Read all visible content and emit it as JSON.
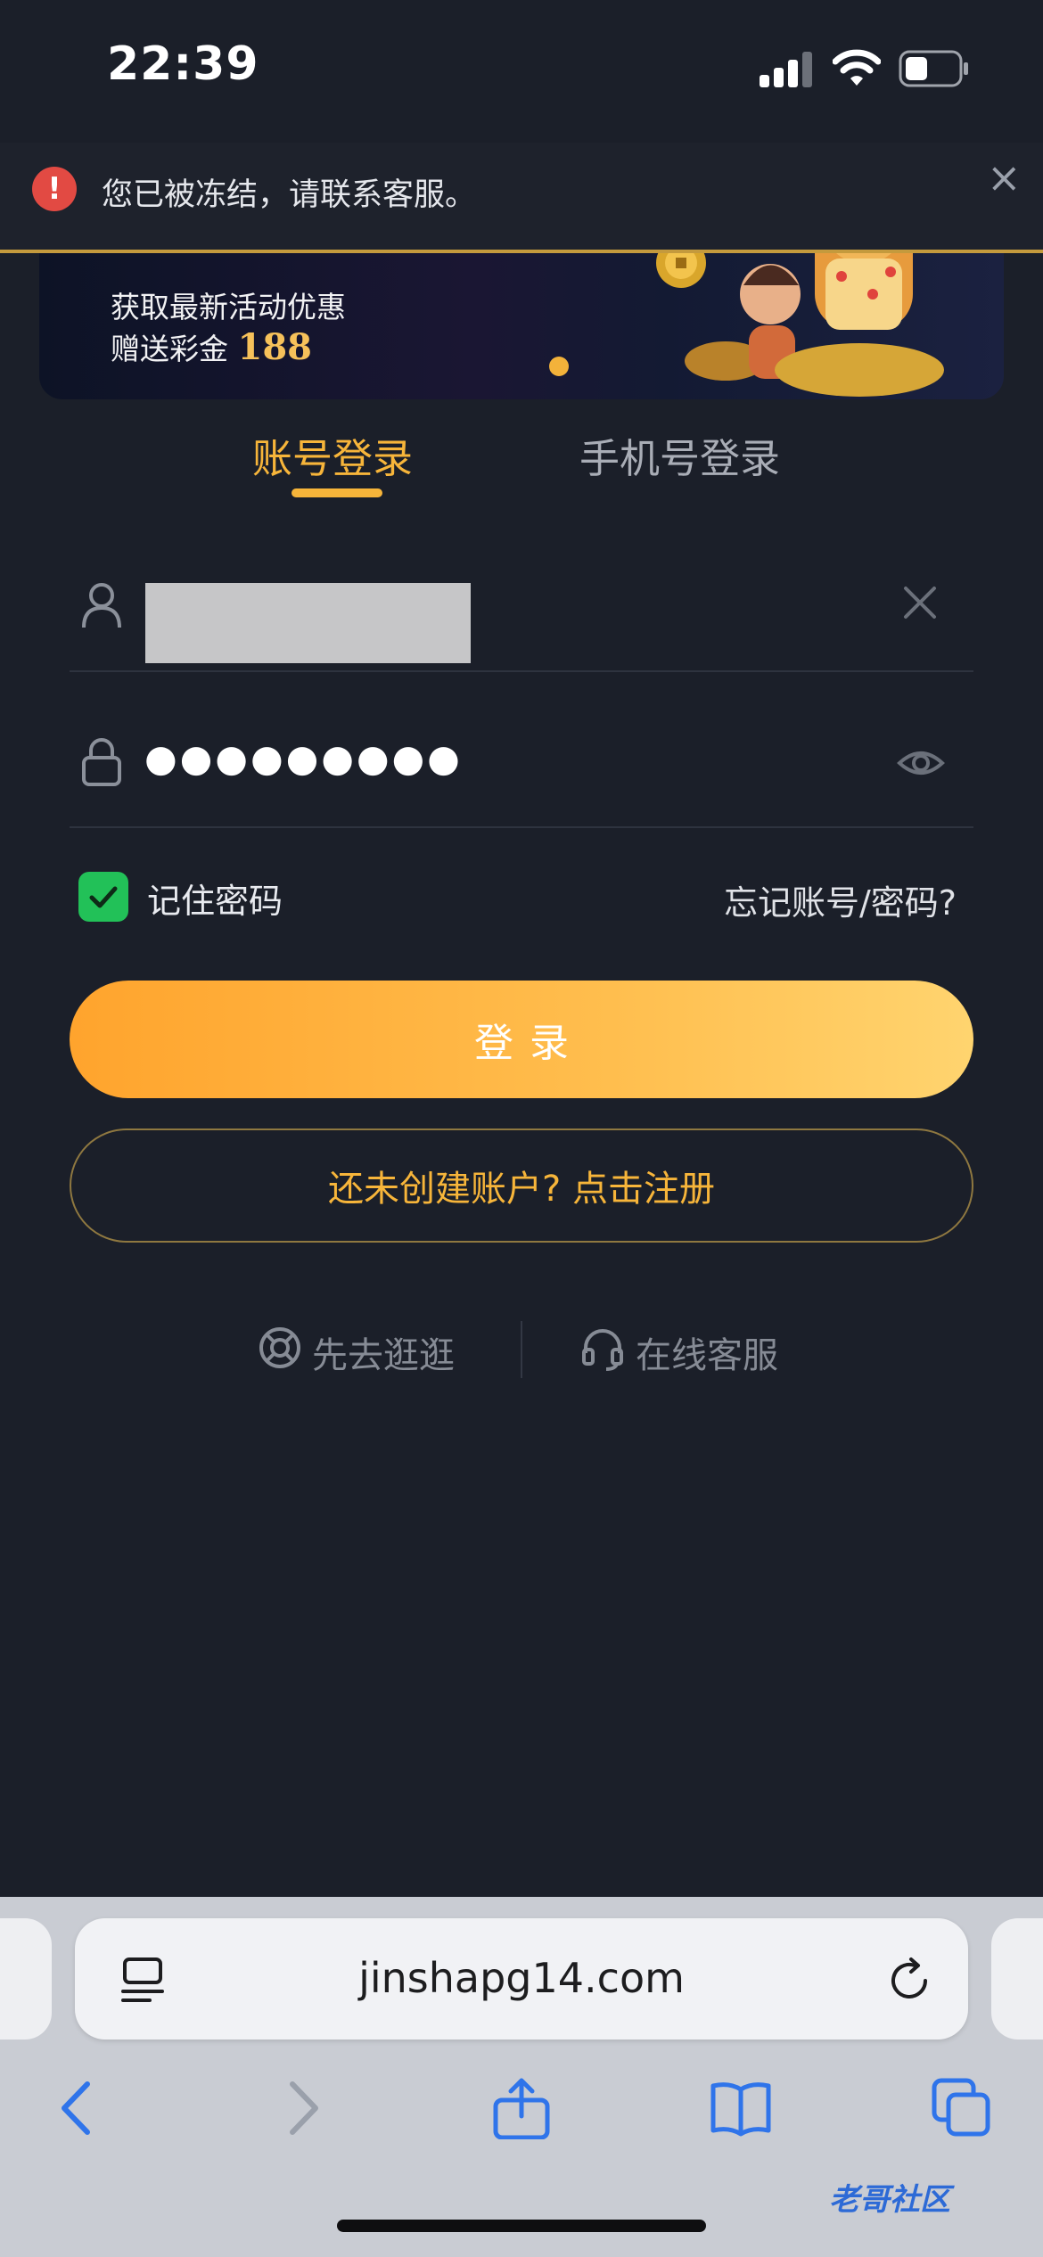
{
  "status_bar": {
    "time": "22:39"
  },
  "notice": {
    "icon": "error-icon",
    "message": "您已被冻结，请联系客服。",
    "close": "×"
  },
  "banner": {
    "line1": "获取最新活动优惠",
    "line2_prefix": "赠送彩金 ",
    "amount": "188"
  },
  "tabs": [
    {
      "label": "账号登录",
      "active": true
    },
    {
      "label": "手机号登录",
      "active": false
    }
  ],
  "form": {
    "username_icon": "user-icon",
    "password_icon": "lock-icon",
    "password_value": "●●●●●●●●●",
    "remember_label": "记住密码",
    "remember_checked": true,
    "forgot_label": "忘记账号/密码?",
    "login_label": "登录",
    "register_label": "还未创建账户? 点击注册"
  },
  "links": {
    "browse_label": "先去逛逛",
    "service_label": "在线客服"
  },
  "browser": {
    "url": "jinshapg14.com"
  },
  "watermark": "老哥社区",
  "colors": {
    "accent": "#f7b53a",
    "background": "#1b1f29",
    "error": "#e24a43",
    "check": "#22c158"
  }
}
